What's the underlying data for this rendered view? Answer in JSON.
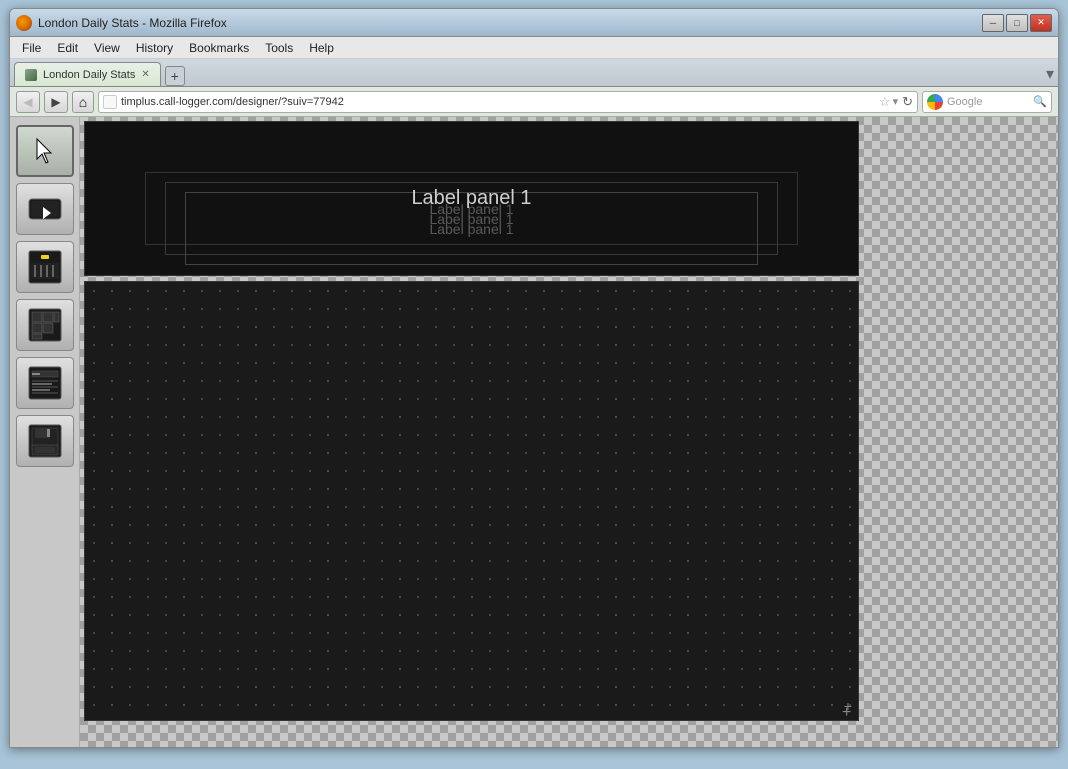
{
  "browser": {
    "title": "London Daily Stats - Mozilla Firefox",
    "tab_title": "London Daily Stats",
    "url": "timplus.call-logger.com/designer/?suiv=77942",
    "search_placeholder": "Google"
  },
  "menu": {
    "items": [
      "File",
      "Edit",
      "View",
      "History",
      "Bookmarks",
      "Tools",
      "Help"
    ]
  },
  "nav": {
    "back": "◀",
    "forward": "▶",
    "home": "⌂",
    "reload": "↺"
  },
  "canvas": {
    "label_panel_text_1": "Label panel 1",
    "label_panel_text_2": "Label panel 1",
    "label_panel_text_3": "Label panel 1",
    "label_panel_text_4": "Label panel 1"
  },
  "toolbar": {
    "tools": [
      {
        "name": "select",
        "label": "Select"
      },
      {
        "name": "widget",
        "label": "Widget"
      },
      {
        "name": "gauge",
        "label": "Gauge"
      },
      {
        "name": "grid",
        "label": "Grid"
      },
      {
        "name": "list",
        "label": "List"
      },
      {
        "name": "save",
        "label": "Save"
      }
    ]
  }
}
